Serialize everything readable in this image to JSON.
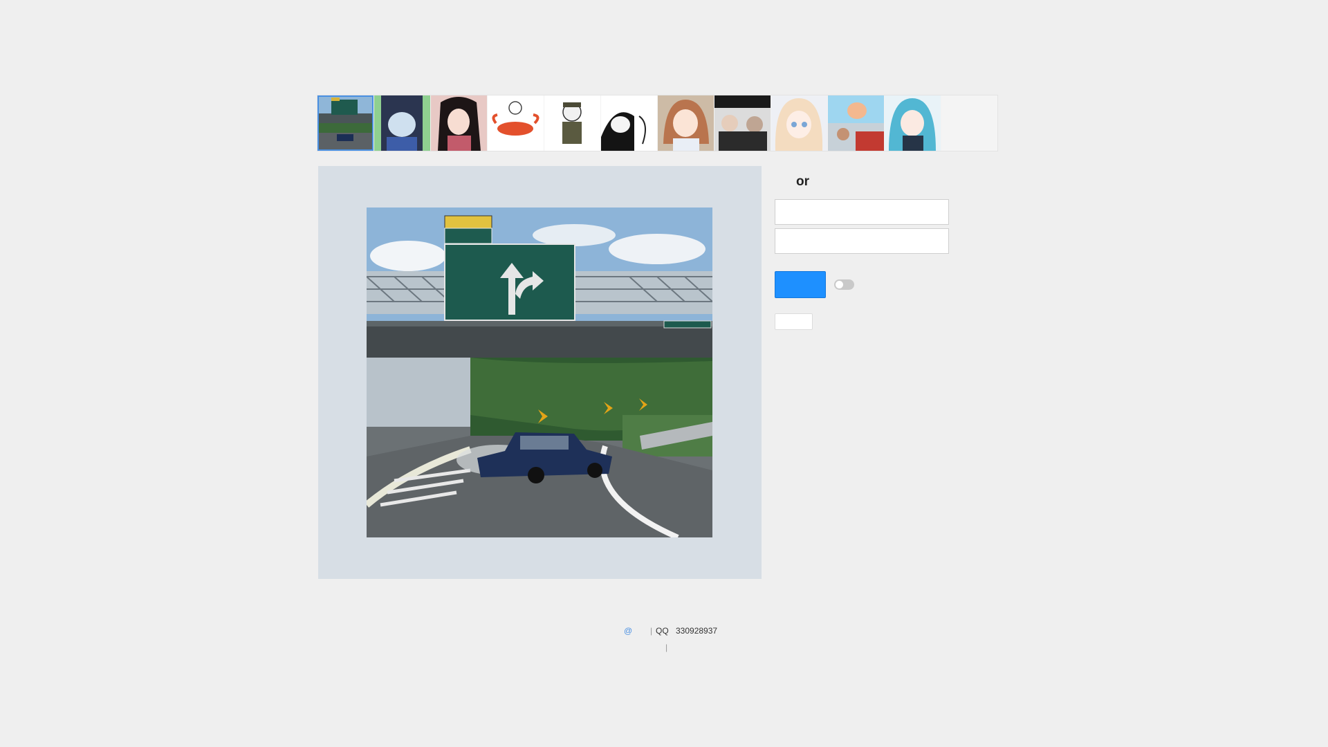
{
  "thumbnails": [
    {
      "name": "thumb-left-exit-meme",
      "selected": true
    },
    {
      "name": "thumb-anime-girl-crying"
    },
    {
      "name": "thumb-anime-girl-black-hair"
    },
    {
      "name": "thumb-lobster-sketch"
    },
    {
      "name": "thumb-panda-soldier"
    },
    {
      "name": "thumb-panda-face-pointing"
    },
    {
      "name": "thumb-anime-girl-brown-hair"
    },
    {
      "name": "thumb-men-reaction"
    },
    {
      "name": "thumb-anime-girl-blonde"
    },
    {
      "name": "thumb-anime-reaction-split"
    },
    {
      "name": "thumb-anime-girl-blue-hair"
    }
  ],
  "form": {
    "or_label": "or",
    "input_top_value": "",
    "input_top_placeholder": "",
    "input_bottom_value": "",
    "input_bottom_placeholder": "",
    "primary_button_label": "",
    "small_button_label": ""
  },
  "footer": {
    "at_symbol": "@",
    "separator": "|",
    "qq_label": "QQ",
    "qq_number": "330928937",
    "line2_separator": "|"
  },
  "colors": {
    "accent": "#1e90ff",
    "panel_bg": "#d7dee5",
    "page_bg": "#efefef"
  }
}
